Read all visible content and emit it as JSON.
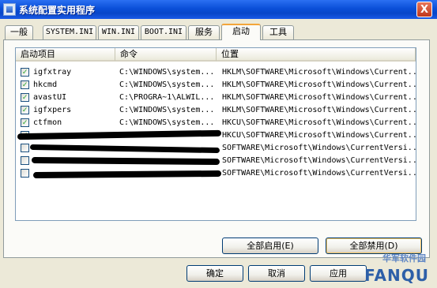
{
  "window": {
    "title": "系统配置实用程序",
    "close_glyph": "X"
  },
  "tabs": [
    {
      "label": "一般"
    },
    {
      "label": "SYSTEM.INI"
    },
    {
      "label": "WIN.INI"
    },
    {
      "label": "BOOT.INI"
    },
    {
      "label": "服务"
    },
    {
      "label": "启动",
      "active": true
    },
    {
      "label": "工具"
    }
  ],
  "columns": {
    "item": "启动项目",
    "command": "命令",
    "location": "位置"
  },
  "rows": [
    {
      "checked": true,
      "item": "igfxtray",
      "command": "C:\\WINDOWS\\system...",
      "location": "HKLM\\SOFTWARE\\Microsoft\\Windows\\Current..."
    },
    {
      "checked": true,
      "item": "hkcmd",
      "command": "C:\\WINDOWS\\system...",
      "location": "HKLM\\SOFTWARE\\Microsoft\\Windows\\Current..."
    },
    {
      "checked": true,
      "item": "avastUI",
      "command": "C:\\PROGRA~1\\ALWIL...",
      "location": "HKLM\\SOFTWARE\\Microsoft\\Windows\\Current..."
    },
    {
      "checked": true,
      "item": "igfxpers",
      "command": "C:\\WINDOWS\\system...",
      "location": "HKLM\\SOFTWARE\\Microsoft\\Windows\\Current..."
    },
    {
      "checked": true,
      "item": "ctfmon",
      "command": "C:\\WINDOWS\\system...",
      "location": "HKCU\\SOFTWARE\\Microsoft\\Windows\\Current..."
    },
    {
      "checked": true,
      "item": "",
      "command": "",
      "location": "HKCU\\SOFTWARE\\Microsoft\\Windows\\Current..."
    },
    {
      "checked": false,
      "item": "",
      "command": "",
      "location": "SOFTWARE\\Microsoft\\Windows\\CurrentVersi..."
    },
    {
      "checked": false,
      "item": "",
      "command": "",
      "location": "SOFTWARE\\Microsoft\\Windows\\CurrentVersi..."
    },
    {
      "checked": false,
      "item": "",
      "command": "",
      "location": "SOFTWARE\\Microsoft\\Windows\\CurrentVersi..."
    }
  ],
  "buttons": {
    "enable_all": "全部启用(E)",
    "disable_all": "全部禁用(D)",
    "ok": "确定",
    "cancel": "取消",
    "apply": "应用"
  },
  "watermark": {
    "text": "FANQU",
    "sub": "华军软件园"
  },
  "colors": {
    "titlebar": "#0a4fd8",
    "face": "#ece9d8",
    "check": "#21a121"
  }
}
